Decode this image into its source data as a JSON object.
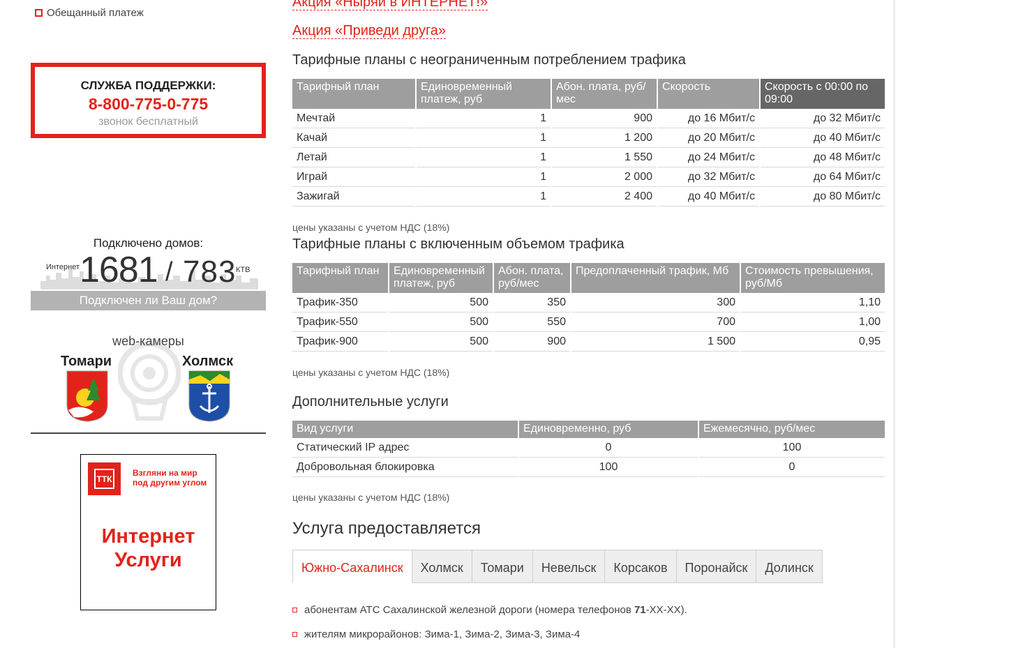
{
  "sidebar": {
    "promised_payment": "Обещанный платеж",
    "support": {
      "title": "СЛУЖБА ПОДДЕРЖКИ:",
      "phone": "8-800-775-0-775",
      "note": "звонок бесплатный"
    },
    "homes": {
      "title": "Подключено домов:",
      "internet_label": "Интернет",
      "internet_count": "1681",
      "slash": "/",
      "ktv_count": "783",
      "ktv_label": "КТВ",
      "check_link": "Подключен ли Ваш дом?"
    },
    "webcams": {
      "title": "web-камеры",
      "city1": "Томари",
      "city2": "Холмск"
    },
    "ad": {
      "logo": "ТТК",
      "slogan_line1": "Взгляни на мир",
      "slogan_line2": "под другим углом",
      "big_line1": "Интернет",
      "big_line2": "Услуги"
    }
  },
  "main": {
    "promo1": "Акция «Ныряй в ИНТЕРНЕТ!»",
    "promo2": "Акция «Приведи друга»",
    "unlimited": {
      "title": "Тарифные планы с неограниченным потреблением трафика",
      "headers": [
        "Тарифный план",
        "Единовременный платеж, руб",
        "Абон. плата, руб/мес",
        "Скорость",
        "Скорость с 00:00 по 09:00"
      ],
      "rows": [
        [
          "Мечтай",
          "1",
          "900",
          "до 16 Мбит/с",
          "до 32 Мбит/с"
        ],
        [
          "Качай",
          "1",
          "1 200",
          "до 20 Мбит/с",
          "до 40 Мбит/с"
        ],
        [
          "Летай",
          "1",
          "1 550",
          "до 24 Мбит/с",
          "до 48 Мбит/с"
        ],
        [
          "Играй",
          "1",
          "2 000",
          "до 32 Мбит/с",
          "до 64 Мбит/с"
        ],
        [
          "Зажигай",
          "1",
          "2 400",
          "до 40 Мбит/с",
          "до 80 Мбит/с"
        ]
      ],
      "note": "цены указаны с учетом НДС (18%)"
    },
    "volume": {
      "title": "Тарифные планы с включенным объемом трафика",
      "headers": [
        "Тарифный план",
        "Единовременный платеж, руб",
        "Абон. плата, руб/мес",
        "Предоплаченный трафик, Мб",
        "Стоимость превышения, руб/Мб"
      ],
      "rows": [
        [
          "Трафик-350",
          "500",
          "350",
          "300",
          "1,10"
        ],
        [
          "Трафик-550",
          "500",
          "550",
          "700",
          "1,00"
        ],
        [
          "Трафик-900",
          "500",
          "900",
          "1 500",
          "0,95"
        ]
      ],
      "note": "цены указаны с учетом НДС (18%)"
    },
    "extra": {
      "title": "Дополнительные услуги",
      "headers": [
        "Вид услуги",
        "Единовременно, руб",
        "Ежемесячно, руб/мес"
      ],
      "rows": [
        [
          "Статический IP адрес",
          "0",
          "100"
        ],
        [
          "Добровольная блокировка",
          "100",
          "0"
        ]
      ],
      "note": "цены указаны с учетом НДС (18%)"
    },
    "availability": {
      "title": "Услуга предоставляется",
      "tabs": [
        "Южно-Сахалинск",
        "Холмск",
        "Томари",
        "Невельск",
        "Корсаков",
        "Поронайск",
        "Долинск"
      ],
      "active_tab": "Южно-Сахалинск",
      "items": [
        {
          "before": "абонентам АТС Сахалинской железной дороги (номера телефонов ",
          "bold": "71",
          "after": "-XX-XX)."
        },
        {
          "before": "жителям микрорайонов: Зима-1, Зима-2, Зима-3, Зима-4",
          "bold": "",
          "after": ""
        }
      ]
    }
  },
  "colors": {
    "accent": "#e2231a",
    "header_gray": "#9e9e9e",
    "header_dark": "#666666"
  }
}
